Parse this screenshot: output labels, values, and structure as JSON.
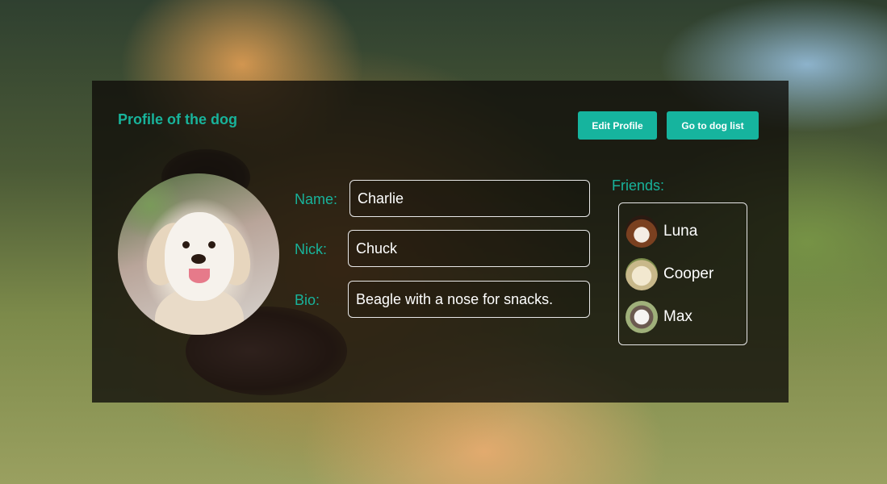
{
  "profile": {
    "title": "Profile of the dog",
    "edit_button": "Edit Profile",
    "list_button": "Go to dog list"
  },
  "fields": {
    "name_label": "Name:",
    "name_value": "Charlie",
    "nick_label": "Nick:",
    "nick_value": "Chuck",
    "bio_label": "Bio:",
    "bio_value": "Beagle with a nose for snacks."
  },
  "friends": {
    "label": "Friends:",
    "items": [
      {
        "name": "Luna"
      },
      {
        "name": "Cooper"
      },
      {
        "name": "Max"
      }
    ]
  },
  "colors": {
    "accent": "#18b39b",
    "button": "#16b49e",
    "panel": "rgba(16,14,10,0.80)"
  }
}
